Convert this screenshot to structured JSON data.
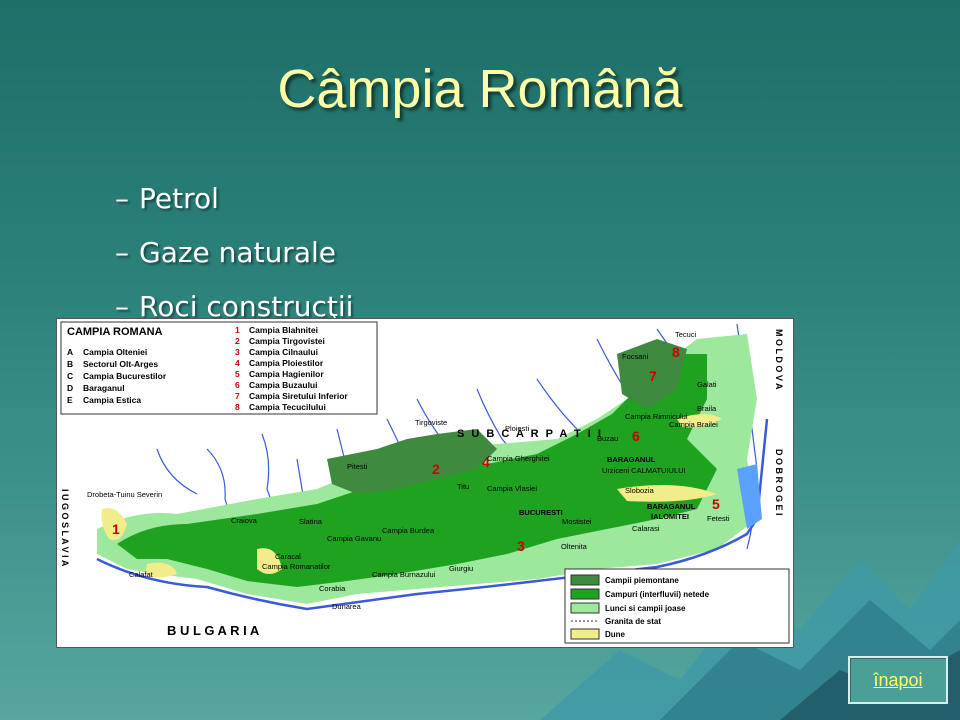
{
  "slide": {
    "title": "Câmpia Română",
    "bullets": [
      "Petrol",
      "Gaze naturale",
      "Roci construcţii"
    ],
    "back_link": "înapoi"
  },
  "map": {
    "title": "CAMPIA ROMANA",
    "regions_letters": [
      {
        "letter": "A",
        "name": "Campia Olteniei"
      },
      {
        "letter": "B",
        "name": "Sectorul Olt-Arges"
      },
      {
        "letter": "C",
        "name": "Campia Bucurestilor"
      },
      {
        "letter": "D",
        "name": "Baraganul"
      },
      {
        "letter": "E",
        "name": "Campia Estica"
      }
    ],
    "regions_numbers": [
      {
        "n": "1",
        "name": "Campia Blahnitei"
      },
      {
        "n": "2",
        "name": "Campia Tirgovistei"
      },
      {
        "n": "3",
        "name": "Campia Cilnaului"
      },
      {
        "n": "4",
        "name": "Campia Ploiestilor"
      },
      {
        "n": "5",
        "name": "Campia Hagienilor"
      },
      {
        "n": "6",
        "name": "Campia Buzaului"
      },
      {
        "n": "7",
        "name": "Campia Siretului Inferior"
      },
      {
        "n": "8",
        "name": "Campia Tecucilului"
      }
    ],
    "legend": [
      {
        "label": "Campii piemontane",
        "color": "#3e8a3e"
      },
      {
        "label": "Campuri (interfluvii) netede",
        "color": "#1fa21f"
      },
      {
        "label": "Lunci si campii joase",
        "color": "#9ce89c"
      },
      {
        "label": "Granita de stat",
        "color": "#333333"
      },
      {
        "label": "Dune",
        "color": "#f2ec8a"
      }
    ],
    "bottom_label": "B U L G A R I A",
    "right_label_1": "M O L D O V A",
    "right_label_2": "D O B R O G E I",
    "left_label": "I U G O S L A V I A",
    "arc_label": "S U B C A R P A T I I",
    "labels": {
      "tirgoviste": "Tirgoviste",
      "ploiesti": "Ploiesti",
      "bucuresti": "BUCURESTI",
      "baraganul1": "BARAGANUL",
      "baraganul2": "BARAGANUL",
      "ialomitei": "IALOMITEI",
      "craiova": "Craiova",
      "calafat": "Calafat",
      "slatina": "Slatina",
      "giurgiu": "Giurgiu",
      "dunarea": "Dunarea",
      "galati": "Galati",
      "braila": "Braila",
      "focsani": "Focsani",
      "tecuci": "Tecuci",
      "buzau": "Buzau",
      "drobeta": "Drobeta-Tuinu Severin",
      "urziceni": "Urziceni CALMATUIULUI",
      "vlasiei": "Campia Vlasiei",
      "burdea": "Campia Burdea",
      "burnazului": "Campia Burnazului",
      "romanatilor": "Campia Romanatilor",
      "gavanu": "Campia Gavanu",
      "mostistei": "Mostistei",
      "slobozia": "Slobozia",
      "fetesti": "Fetesti",
      "calarasi": "Calarasi",
      "oltenita": "Oltenita",
      "gherghitei": "Campia Gherghitei",
      "titu": "Titu",
      "rimnicului": "Campia Rimnicului",
      "brailei": "Campia Brailei",
      "pitesti": "Pitesti",
      "corabia": "Corabia",
      "caracal": "Caracal"
    }
  }
}
